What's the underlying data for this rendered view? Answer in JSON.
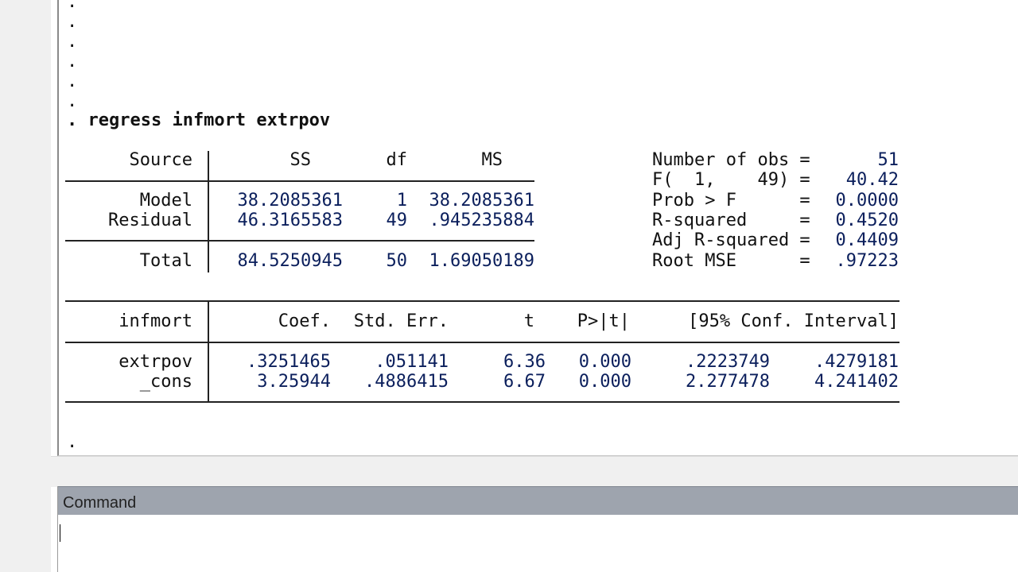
{
  "prompt_dot": ".",
  "command_line": ". regress infmort extrpov",
  "anova": {
    "headers": [
      "Source",
      "SS",
      "df",
      "MS"
    ],
    "rows": [
      {
        "source": "Model",
        "ss": "38.2085361",
        "df": "1",
        "ms": "38.2085361"
      },
      {
        "source": "Residual",
        "ss": "46.3165583",
        "df": "49",
        "ms": ".945235884"
      },
      {
        "source": "Total",
        "ss": "84.5250945",
        "df": "50",
        "ms": "1.69050189"
      }
    ]
  },
  "fit_stats": [
    {
      "label": "Number of obs =",
      "value": "51"
    },
    {
      "label": "F(  1,    49) =",
      "value": "40.42"
    },
    {
      "label": "Prob > F      =",
      "value": "0.0000"
    },
    {
      "label": "R-squared     =",
      "value": "0.4520"
    },
    {
      "label": "Adj R-squared =",
      "value": "0.4409"
    },
    {
      "label": "Root MSE      =",
      "value": ".97223"
    }
  ],
  "coef_table": {
    "depvar": "infmort",
    "headers": [
      "Coef.",
      "Std. Err.",
      "t",
      "P>|t|",
      "[95% Conf. Interval]"
    ],
    "rows": [
      {
        "var": "extrpov",
        "coef": ".3251465",
        "se": ".051141",
        "t": "6.36",
        "p": "0.000",
        "lo": ".2223749",
        "hi": ".4279181"
      },
      {
        "var": "_cons",
        "coef": "3.25944",
        "se": ".4886415",
        "t": "6.67",
        "p": "0.000",
        "lo": "2.277478",
        "hi": "4.241402"
      }
    ]
  },
  "command_window": {
    "title": "Command",
    "value": ""
  }
}
